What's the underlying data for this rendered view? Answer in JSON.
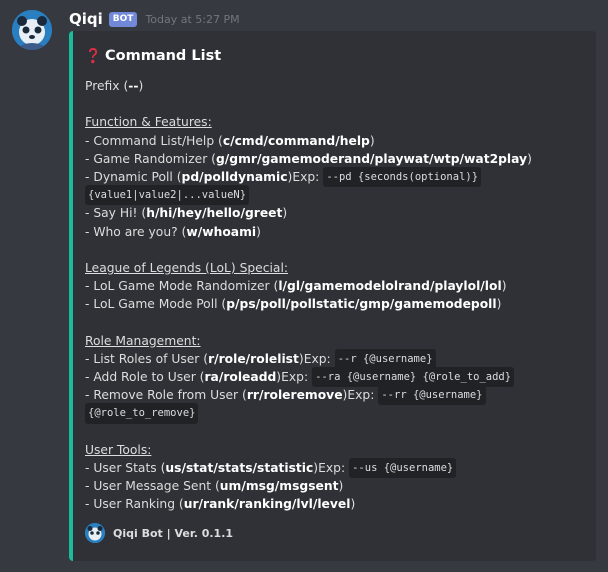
{
  "message": {
    "username": "Qiqi",
    "bot_tag": "BOT",
    "timestamp": "Today at 5:27 PM",
    "avatar_icon": "qiqi-avatar-icon"
  },
  "embed": {
    "accent_color": "#1abc9c",
    "title_icon": "question-mark-icon",
    "title": "Command List",
    "prefix": {
      "label": "Prefix (",
      "value": "--",
      "close": ")"
    },
    "sections": [
      {
        "heading": "Function & Features:",
        "items": [
          {
            "label": "- Command List/Help (",
            "cmd": "c/cmd/command/help",
            "close": ")"
          },
          {
            "label": "- Game Randomizer (",
            "cmd": "g/gmr/gamemoderand/playwat/wtp/wat2play",
            "close": ")"
          },
          {
            "label": "- Dynamic Poll (",
            "cmd": "pd/polldynamic",
            "close": ")",
            "exp": " Exp: ",
            "code": "--pd {seconds(optional)}",
            "code2": "{value1|value2|...valueN}"
          },
          {
            "label": "- Say Hi! (",
            "cmd": "h/hi/hey/hello/greet",
            "close": ")"
          },
          {
            "label": "- Who are you? (",
            "cmd": "w/whoami",
            "close": ")"
          }
        ]
      },
      {
        "heading": "League of Legends (LoL) Special:",
        "items": [
          {
            "label": "- LoL Game Mode Randomizer (",
            "cmd": "l/gl/gamemodelolrand/playlol/lol",
            "close": ")"
          },
          {
            "label": "- LoL Game Mode Poll (",
            "cmd": "p/ps/poll/pollstatic/gmp/gamemodepoll",
            "close": ")"
          }
        ]
      },
      {
        "heading": "Role Management:",
        "items": [
          {
            "label": "- List Roles of User (",
            "cmd": "r/role/rolelist",
            "close": ")",
            "exp": " Exp: ",
            "code": "--r {@username}"
          },
          {
            "label": "- Add Role to User (",
            "cmd": "ra/roleadd",
            "close": ")",
            "exp": " Exp: ",
            "code": "--ra {@username} {@role_to_add}"
          },
          {
            "label": "- Remove Role from User (",
            "cmd": "rr/roleremove",
            "close": ")",
            "exp": " Exp: ",
            "code": "--rr {@username}",
            "code2": "{@role_to_remove}"
          }
        ]
      },
      {
        "heading": "User Tools:",
        "items": [
          {
            "label": "- User Stats (",
            "cmd": "us/stat/stats/statistic",
            "close": ")",
            "exp": " Exp: ",
            "code": "--us {@username}"
          },
          {
            "label": "- User Message Sent (",
            "cmd": "um/msg/msgsent",
            "close": ")"
          },
          {
            "label": "- User Ranking (",
            "cmd": "ur/rank/ranking/lvl/level",
            "close": ")"
          }
        ]
      }
    ],
    "footer": {
      "icon": "qiqi-avatar-icon",
      "text": "Qiqi Bot | Ver. 0.1.1"
    }
  }
}
